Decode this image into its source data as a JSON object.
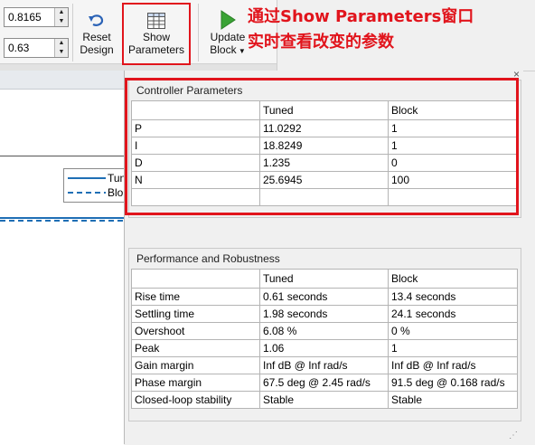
{
  "toolstrip": {
    "spin1_value": "0.8165",
    "spin2_value": "0.63",
    "reset_label_1": "Reset",
    "reset_label_2": "Design",
    "show_label_1": "Show",
    "show_label_2": "Parameters",
    "update_label_1": "Update",
    "update_label_2": "Block"
  },
  "annotation": {
    "line1": "通过Show Parameters窗口",
    "line2": "实时查看改变的参数"
  },
  "plot_legend": {
    "line1": "Tun",
    "line2": "Blo"
  },
  "controller_params": {
    "title": "Controller Parameters",
    "columns": [
      "",
      "Tuned",
      "Block"
    ],
    "rows": [
      [
        "P",
        "11.0292",
        "1"
      ],
      [
        "I",
        "18.8249",
        "1"
      ],
      [
        "D",
        "1.235",
        "0"
      ],
      [
        "N",
        "25.6945",
        "100"
      ],
      [
        "",
        "",
        ""
      ]
    ]
  },
  "performance": {
    "title": "Performance and Robustness",
    "columns": [
      "",
      "Tuned",
      "Block"
    ],
    "rows": [
      [
        "Rise time",
        "0.61 seconds",
        "13.4 seconds"
      ],
      [
        "Settling time",
        "1.98 seconds",
        "24.1 seconds"
      ],
      [
        "Overshoot",
        "6.08 %",
        "0 %"
      ],
      [
        "Peak",
        "1.06",
        "1"
      ],
      [
        "Gain margin",
        "Inf dB @ Inf rad/s",
        "Inf dB @ Inf rad/s"
      ],
      [
        "Phase margin",
        "67.5 deg @ 2.45 rad/s",
        "91.5 deg @ 0.168 rad/s"
      ],
      [
        "Closed-loop stability",
        "Stable",
        "Stable"
      ]
    ]
  },
  "colors": {
    "annotation": "#e1141c",
    "plot_line": "#1f6fb5",
    "update_arrow": "#3aa335"
  }
}
